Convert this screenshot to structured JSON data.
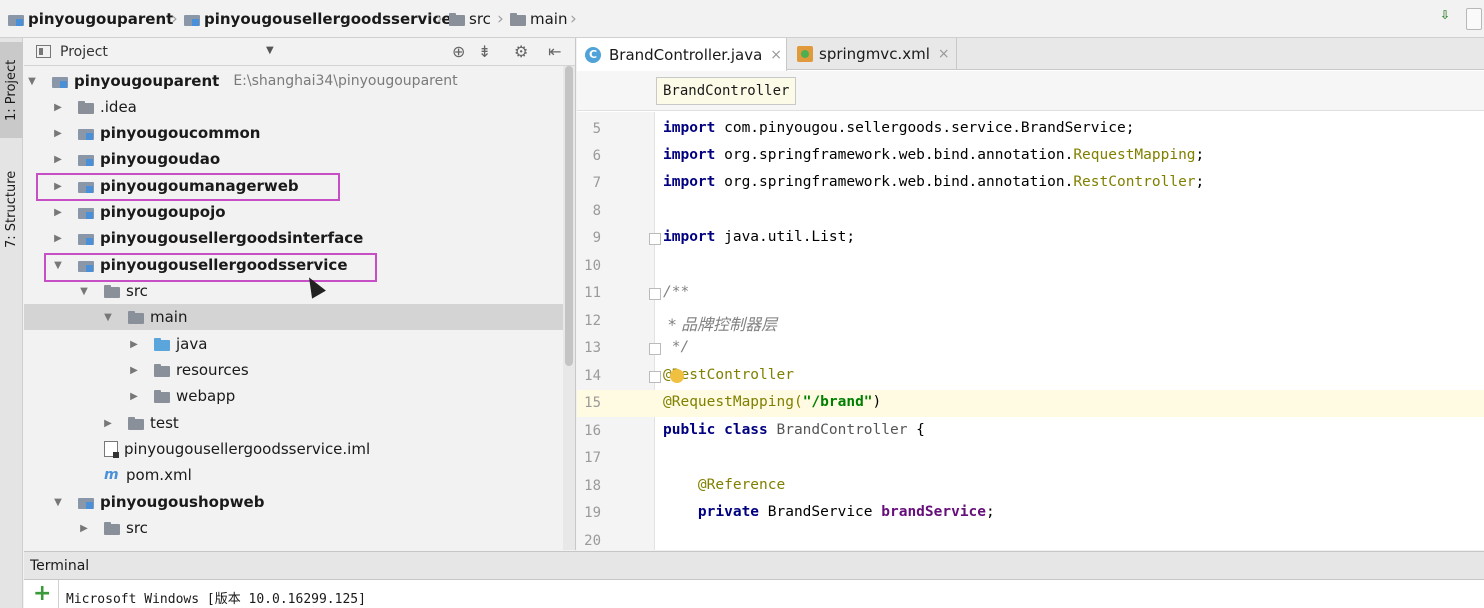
{
  "navbar": {
    "crumbs": [
      "pinyougouparent",
      "pinyougousellergoodsservice",
      "src",
      "main"
    ]
  },
  "stripe": {
    "project_tab": "1: Project",
    "structure_tab": "7: Structure"
  },
  "project_panel": {
    "title": "Project",
    "root": {
      "name": "pinyougouparent",
      "path": "E:\\shanghai34\\pinyougouparent"
    },
    "items": {
      "idea": ".idea",
      "common": "pinyougoucommon",
      "dao": "pinyougoudao",
      "managerweb": "pinyougoumanagerweb",
      "pojo": "pinyougoupojo",
      "interface": "pinyougousellergoodsinterface",
      "service": "pinyougousellergoodsservice",
      "src": "src",
      "main": "main",
      "java": "java",
      "resources": "resources",
      "webapp": "webapp",
      "test": "test",
      "iml": "pinyougousellergoodsservice.iml",
      "pom": "pom.xml",
      "shopweb": "pinyougoushopweb",
      "shop_src": "src"
    }
  },
  "editor": {
    "tabs": [
      "BrandController.java",
      "springmvc.xml"
    ],
    "class_crumb": "BrandController",
    "line_numbers": [
      "5",
      "6",
      "7",
      "8",
      "9",
      "10",
      "11",
      "12",
      "13",
      "14",
      "15",
      "16",
      "17",
      "18",
      "19",
      "20"
    ],
    "code": {
      "l5_kw": "import",
      "l5_rest": " com.pinyougou.sellergoods.service.BrandService;",
      "l6_kw": "import",
      "l6_a": " org.springframework.web.bind.annotation.",
      "l6_b": "RequestMapping",
      "l6_c": ";",
      "l7_kw": "import",
      "l7_a": " org.springframework.web.bind.annotation.",
      "l7_b": "RestController",
      "l7_c": ";",
      "l9_kw": "import",
      "l9_rest": " java.util.List;",
      "l11": "/**",
      "l12": " * 品牌控制器层",
      "l13": " */",
      "l14": "@RestController",
      "l15_a": "@RequestMapping(",
      "l15_b": "\"/brand\"",
      "l15_c": ")",
      "l16_kw": "public class",
      "l16_name": " BrandController",
      "l16_c": " {",
      "l18": "    @Reference",
      "l19_kw": "    private",
      "l19_type": " BrandService ",
      "l19_field": "brandService",
      "l19_c": ";"
    }
  },
  "terminal": {
    "title": "Terminal",
    "output": "Microsoft Windows [版本 10.0.16299.125]"
  },
  "colors": {
    "highlight_box": "#c64fc6",
    "current_line": "#fffbe2"
  }
}
